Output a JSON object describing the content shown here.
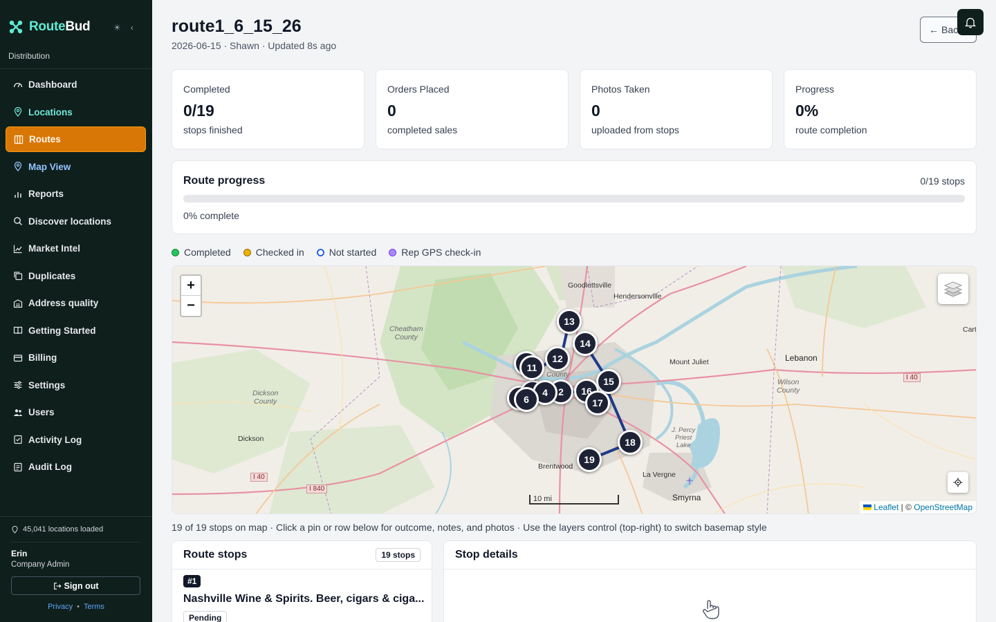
{
  "app": {
    "brand_route": "Route",
    "brand_bud": "Bud",
    "org": "Distribution",
    "accent": "#d97706"
  },
  "sidebar": {
    "items": [
      {
        "label": "Dashboard",
        "icon": "dashboard-gauge-icon"
      },
      {
        "label": "Locations",
        "icon": "map-pin-icon"
      },
      {
        "label": "Routes",
        "icon": "columns-icon"
      },
      {
        "label": "Map View",
        "icon": "map-pin-icon"
      },
      {
        "label": "Reports",
        "icon": "bar-chart-icon"
      },
      {
        "label": "Discover locations",
        "icon": "search-icon"
      },
      {
        "label": "Market Intel",
        "icon": "trend-line-icon"
      },
      {
        "label": "Duplicates",
        "icon": "copy-icon"
      },
      {
        "label": "Address quality",
        "icon": "building-icon"
      },
      {
        "label": "Getting Started",
        "icon": "book-icon"
      },
      {
        "label": "Billing",
        "icon": "credit-card-icon"
      },
      {
        "label": "Settings",
        "icon": "sliders-icon"
      },
      {
        "label": "Users",
        "icon": "users-icon"
      },
      {
        "label": "Activity Log",
        "icon": "activity-log-icon"
      },
      {
        "label": "Audit Log",
        "icon": "audit-log-icon"
      }
    ],
    "loaded": "45,041 locations loaded",
    "user_name": "Erin",
    "user_role": "Company Admin",
    "signout": "Sign out",
    "privacy": "Privacy",
    "terms": "Terms"
  },
  "header": {
    "title": "route1_6_15_26",
    "subtitle": "2026-06-15 · Shawn · Updated 8s ago",
    "back_label": "Back"
  },
  "stats": [
    {
      "label": "Completed",
      "value": "0/19",
      "sub": "stops finished"
    },
    {
      "label": "Orders Placed",
      "value": "0",
      "sub": "completed sales"
    },
    {
      "label": "Photos Taken",
      "value": "0",
      "sub": "uploaded from stops"
    },
    {
      "label": "Progress",
      "value": "0%",
      "sub": "route completion"
    }
  ],
  "progress": {
    "title": "Route progress",
    "count": "0/19 stops",
    "percent_label": "0% complete",
    "fraction": 0
  },
  "legend": [
    {
      "label": "Completed",
      "color": "#22c55e"
    },
    {
      "label": "Checked in",
      "color": "#eab308"
    },
    {
      "label": "Not started",
      "color": "#2563eb"
    },
    {
      "label": "Rep GPS check-in",
      "color": "#a78bfa"
    }
  ],
  "map": {
    "zoom_in": "+",
    "zoom_out": "−",
    "places": {
      "goodlettsville": "Goodlettsville",
      "hendersonville": "Hendersonville",
      "cheatham": "Cheatham\nCounty",
      "mount_juliet": "Mount Juliet",
      "lebanon": "Lebanon",
      "carth": "Carth",
      "wilson": "Wilson\nCounty",
      "dickson_county": "Dickson\nCounty",
      "dickson": "Dickson",
      "percy": "J. Percy\nPriest\nLake",
      "brentwood": "Brentwood",
      "lavergne": "La Vergne",
      "smyrna": "Smyrna",
      "county": "County"
    },
    "highways": [
      "I 40",
      "I 40",
      "I 840"
    ],
    "scale": "10 mi",
    "attribution_leaflet": "Leaflet",
    "attribution_sep": " | © ",
    "attribution_osm": "OpenStreetMap",
    "pins": [
      "13",
      "14",
      "12",
      "11",
      "15",
      "16",
      "17",
      "4",
      "2",
      "6",
      "18",
      "19"
    ],
    "note": "19 of 19 stops on map · Click a pin or row below for outcome, notes, and photos · Use the layers control (top-right) to switch basemap style"
  },
  "stops": {
    "title": "Route stops",
    "badge": "19 stops",
    "first": {
      "num": "#1",
      "name": "Nashville Wine & Spirits. Beer, cigars & ciga...",
      "status": "Pending"
    }
  },
  "details": {
    "title": "Stop details"
  }
}
